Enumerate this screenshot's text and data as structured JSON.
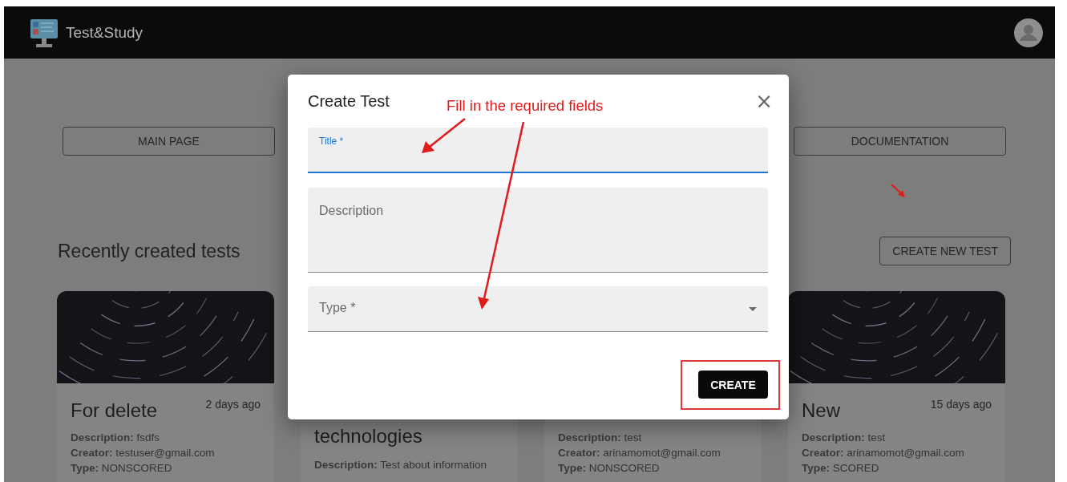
{
  "app": {
    "title": "Test&Study"
  },
  "nav": [
    "MAIN PAGE",
    "DOCUMENTATION"
  ],
  "section": {
    "heading": "Recently created tests",
    "action": "CREATE NEW TEST"
  },
  "cards": [
    {
      "kind": "picture",
      "title": "For delete",
      "date": "2 days ago",
      "details": [
        "**Description:** fsdfs",
        "**Creator:** testuser@gmail.com",
        "**Type:** NONSCORED"
      ]
    },
    {
      "title": "technologies",
      "details": [
        "**Description:** Test about information"
      ]
    },
    {
      "details": [
        "**Description:** test",
        "**Creator:** arinamomot@gmail.com",
        "**Type:** NONSCORED"
      ]
    },
    {
      "kind": "picture",
      "title": "New",
      "date": "15 days ago",
      "details": [
        "**Description:** test",
        "**Creator:** arinamomot@gmail.com",
        "**Type:** SCORED"
      ]
    }
  ],
  "dialog": {
    "title": "Create Test",
    "close": "×",
    "fields": [
      {
        "kind": "text",
        "label": "Title *",
        "focused": true
      },
      {
        "kind": "textarea",
        "label": "Description",
        "focused": false
      },
      {
        "kind": "select",
        "label": "Type *",
        "focused": false
      }
    ],
    "button": "CREATE"
  },
  "annotation": {
    "text": "Fill in the required fields"
  }
}
